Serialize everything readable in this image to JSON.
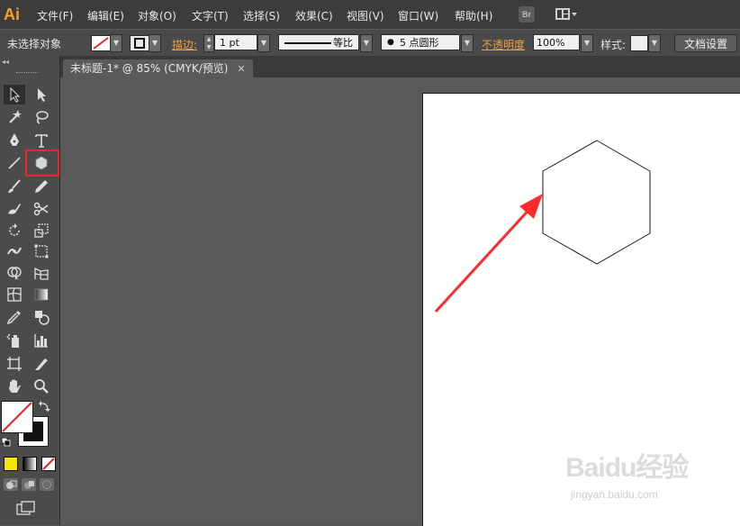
{
  "app": {
    "logo": "Ai",
    "bridge_label": "Br"
  },
  "menu": [
    "文件(F)",
    "编辑(E)",
    "对象(O)",
    "文字(T)",
    "选择(S)",
    "效果(C)",
    "视图(V)",
    "窗口(W)",
    "帮助(H)"
  ],
  "control": {
    "selection_status": "未选择对象",
    "stroke_label": "描边:",
    "stroke_weight": "1 pt",
    "stroke_profile": "等比",
    "brush": "5 点圆形",
    "opacity_label": "不透明度",
    "opacity_value": "100%",
    "style_label": "样式:",
    "doc_setup": "文档设置"
  },
  "document": {
    "tab_title": "未标题-1* @ 85% (CMYK/预览)",
    "close_glyph": "✕"
  },
  "toolbar": {
    "collapse_glyph": "◂◂",
    "highlighted_tool": "polygon-tool"
  },
  "watermark": {
    "main": "Baidu经验",
    "sub": "jingyan.baidu.com"
  },
  "colors": {
    "menubar_bg": "#3c3c3c",
    "controlbar_bg": "#4a4a4a",
    "toolbar_bg": "#4b4b4b",
    "canvas_bg": "#595959",
    "artboard_bg": "#ffffff",
    "accent_link": "#f0a040",
    "ai_logo": "#f7a12b",
    "highlight_red": "#e8262a",
    "arrow_red": "#ff2a2a"
  }
}
